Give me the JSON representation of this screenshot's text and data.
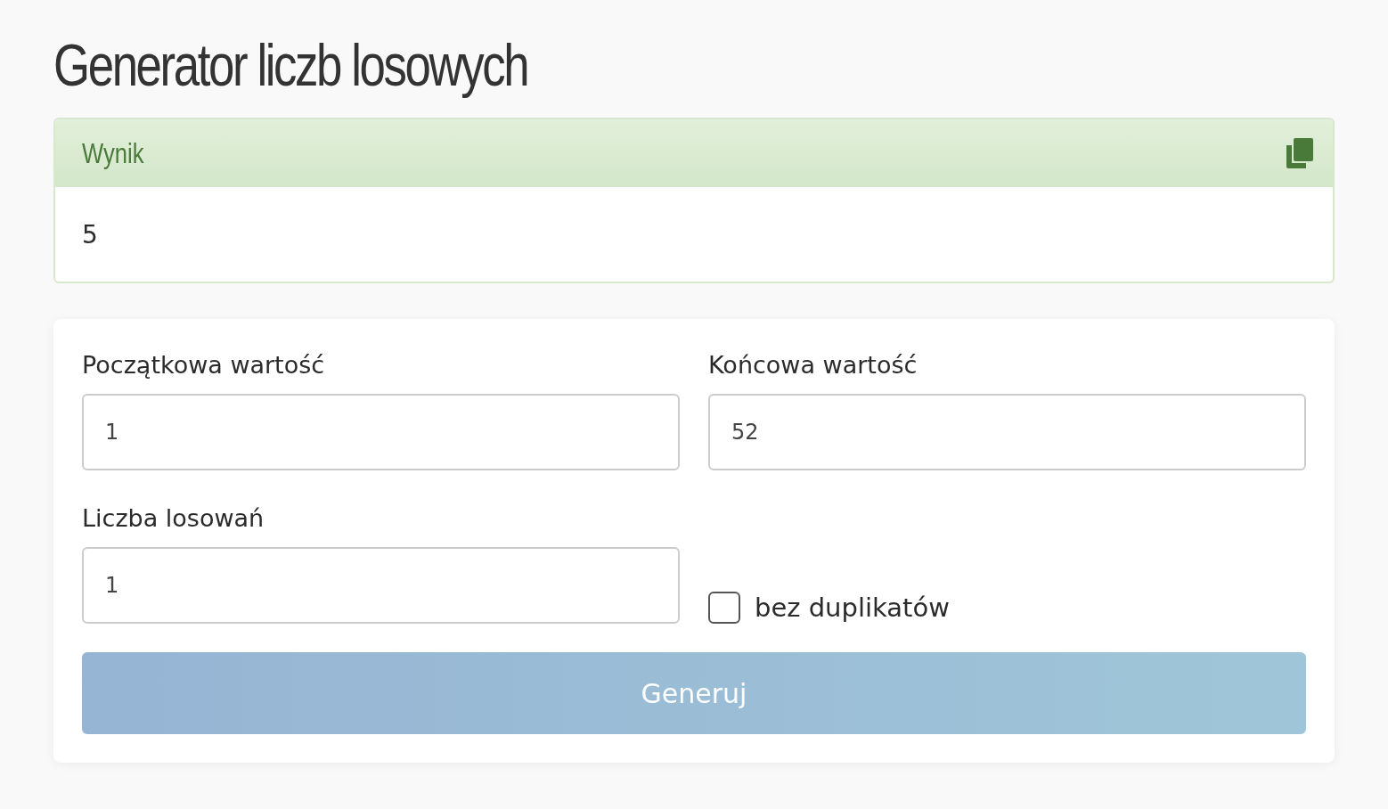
{
  "title": "Generator liczb losowych",
  "result": {
    "heading": "Wynik",
    "value": "5"
  },
  "fields": [
    {
      "label": "Początkowa wartość",
      "value": "1"
    },
    {
      "label": "Końcowa wartość",
      "value": "52"
    },
    {
      "label": "Liczba losowań",
      "value": "1"
    }
  ],
  "checkbox": {
    "label": "bez duplikatów",
    "checked": false
  },
  "button": {
    "label": "Generuj",
    "disabled": true
  }
}
